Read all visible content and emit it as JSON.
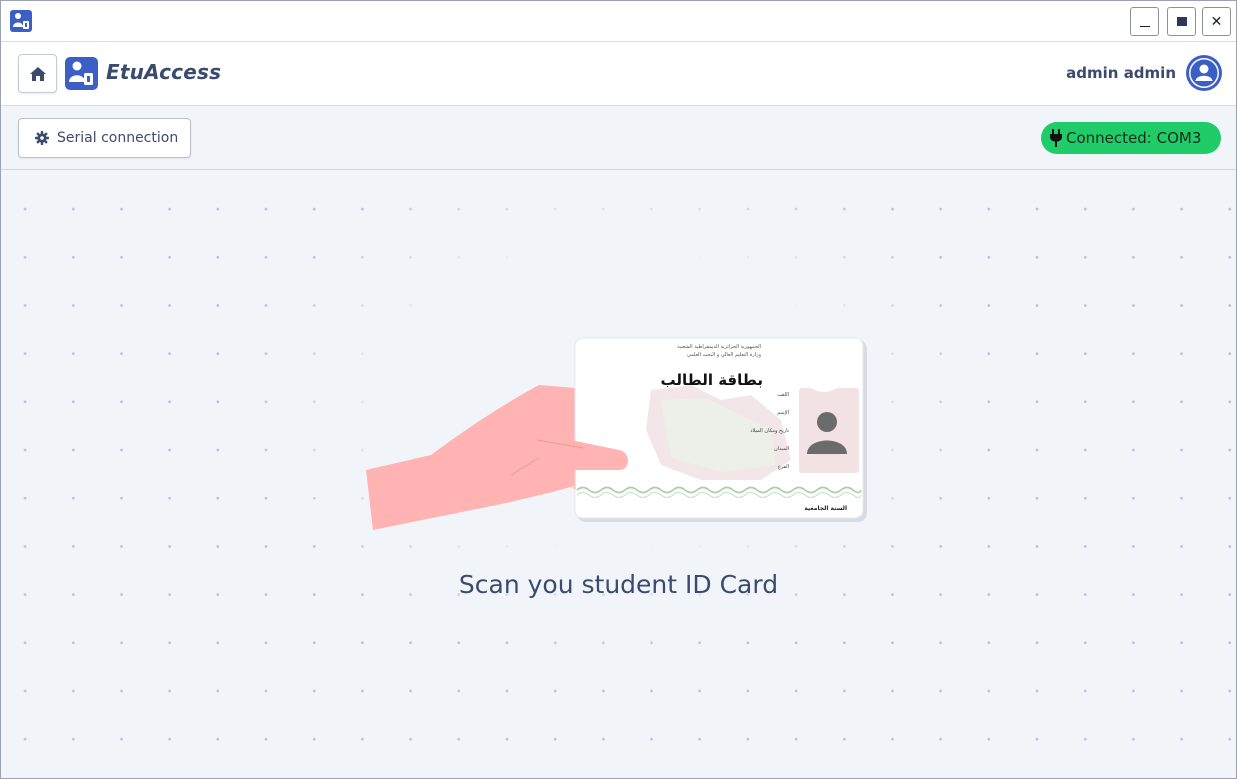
{
  "titlebar": {
    "app_icon": "app-icon",
    "controls": {
      "minimize": "minimize-icon",
      "maximize": "maximize-icon",
      "close_label": "✕"
    }
  },
  "header": {
    "brand_name": "EtuAccess",
    "user_name": "admin admin",
    "home_icon": "home-icon",
    "avatar_icon": "user-icon",
    "accent_color": "#3c5fc6"
  },
  "toolbar": {
    "serial_button_label": "Serial connection",
    "serial_icon": "gear-icon",
    "status_label": "Connected: COM3",
    "status_icon": "plug-icon",
    "status_color": "#1fcc68"
  },
  "main": {
    "prompt": "Scan you student ID Card",
    "card": {
      "title": "بطاقة الطالب",
      "header_line1": "الجمهورية الجزائرية الديمقراطية الشعبية",
      "header_line2": "وزارة التعليم العالي و البحث العلمي",
      "field_1": "اللقب",
      "field_2": "الإسم",
      "field_3": "تاريخ ومكان الميلاد",
      "field_4": "الميدان",
      "field_5": "الفرع",
      "footer": "السنة الجامعية"
    }
  }
}
